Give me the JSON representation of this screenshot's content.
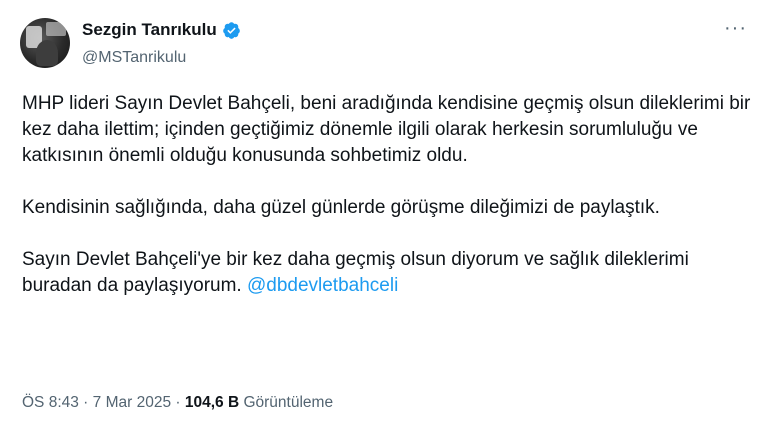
{
  "author": {
    "name": "Sezgin Tanrıkulu",
    "handle": "@MSTanrikulu",
    "verified_icon": "verified-badge-icon",
    "accent_color": "#1d9bf0"
  },
  "more_label": "···",
  "tweet": {
    "paragraphs": [
      "MHP lideri Sayın Devlet Bahçeli, beni aradığında kendisine geçmiş olsun dileklerimi bir kez daha ilettim; içinden geçtiğimiz dönemle ilgili olarak herkesin sorumluluğu ve katkısının önemli olduğu konusunda sohbetimiz oldu.",
      "Kendisinin sağlığında, daha güzel günlerde görüşme dileğimizi de paylaştık.",
      "Sayın Devlet Bahçeli'ye bir kez daha geçmiş olsun diyorum ve sağlık dileklerimi buradan da paylaşıyorum."
    ],
    "mention": "@dbdevletbahceli"
  },
  "meta": {
    "time": "ÖS 8:43",
    "date": "7 Mar 2025",
    "views_count": "104,6 B",
    "views_label": "Görüntüleme"
  }
}
